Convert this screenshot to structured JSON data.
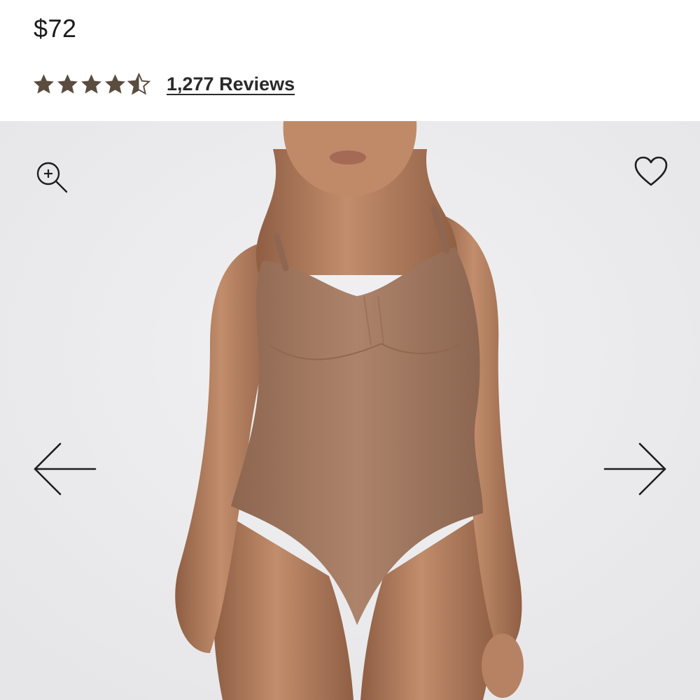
{
  "product": {
    "price": "$72",
    "rating": 4.5,
    "rating_max": 5,
    "reviews_label": "1,277 Reviews"
  },
  "icons": {
    "zoom": "zoom-in-icon",
    "wishlist": "heart-icon",
    "prev": "arrow-left-icon",
    "next": "arrow-right-icon",
    "star": "star-icon"
  },
  "colors": {
    "star": "#5b4c40",
    "gallery_bg": "#ececee",
    "bodysuit": "#a57a62",
    "skin": "#b98565"
  }
}
